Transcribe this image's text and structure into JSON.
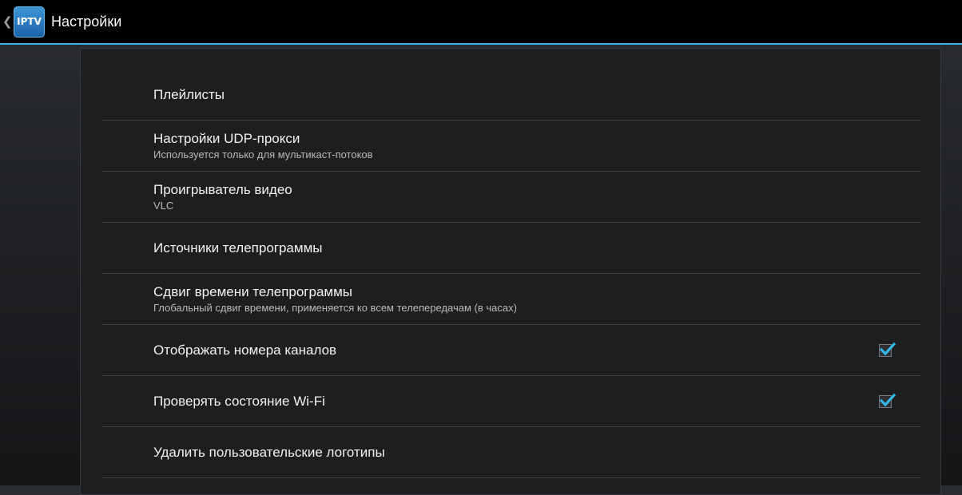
{
  "action_bar": {
    "title": "Настройки",
    "app_icon_label": "IPTV",
    "up_icon": "chevron-left-icon"
  },
  "colors": {
    "accent": "#33b5e5",
    "action_bar_bg": "#000000",
    "panel_bg": "#1d1e20"
  },
  "settings": [
    {
      "title": "Плейлисты",
      "summary": "",
      "checkbox": null
    },
    {
      "title": "Настройки UDP-прокси",
      "summary": "Используется только для мультикаст-потоков",
      "checkbox": null
    },
    {
      "title": "Проигрыватель видео",
      "summary": "VLC",
      "checkbox": null
    },
    {
      "title": "Источники телепрограммы",
      "summary": "",
      "checkbox": null
    },
    {
      "title": "Сдвиг времени телепрограммы",
      "summary": "Глобальный сдвиг времени, применяется ко всем телепередачам (в часах)",
      "checkbox": null
    },
    {
      "title": "Отображать номера каналов",
      "summary": "",
      "checkbox": true
    },
    {
      "title": "Проверять состояние Wi-Fi",
      "summary": "",
      "checkbox": true
    },
    {
      "title": "Удалить пользовательские логотипы",
      "summary": "",
      "checkbox": null
    }
  ]
}
